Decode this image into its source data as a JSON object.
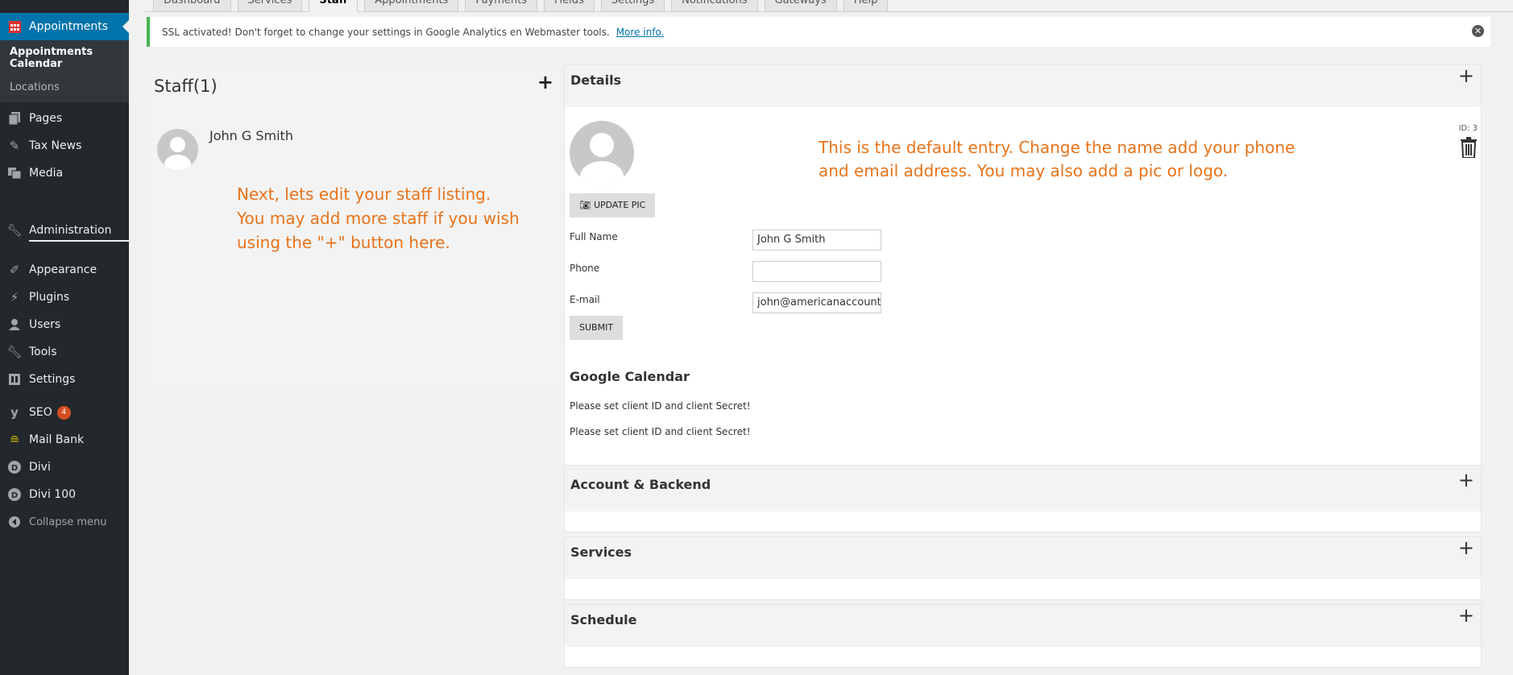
{
  "sidebar": {
    "active_item": "Appointments",
    "submenu": {
      "current": "Appointments Calendar",
      "items": [
        "Locations"
      ]
    },
    "items_group1": [
      "Pages",
      "Tax News",
      "Media"
    ],
    "admin_label": "Administration",
    "items_group2": [
      "Appearance",
      "Plugins",
      "Users",
      "Tools",
      "Settings"
    ],
    "seo_label": "SEO",
    "seo_badge": "4",
    "items_group3": [
      "Mail Bank",
      "Divi",
      "Divi 100"
    ],
    "collapse_label": "Collapse menu"
  },
  "tabs": [
    "Dashboard",
    "Services",
    "Staff",
    "Appointments",
    "Payments",
    "Fields",
    "Settings",
    "Notifications",
    "Gateways",
    "Help"
  ],
  "active_tab": "Staff",
  "notice": {
    "text": "SSL activated!  Don't forget to change your settings in Google Analytics en Webmaster tools.",
    "link": "More info."
  },
  "staff": {
    "title": "Staff(1)",
    "add_symbol": "+",
    "member_name": "John G Smith",
    "note": [
      "Next, lets edit your staff listing.",
      "You may add more staff if you wish",
      "using the \"+\" button here."
    ]
  },
  "details": {
    "title": "Details",
    "id_label": "ID: 3",
    "update_pic_label": "UPDATE PIC",
    "note": [
      "This is the default entry. Change the name add your phone",
      "and email address. You may also add a pic or logo."
    ],
    "fields": {
      "full_name_label": "Full Name",
      "full_name_value": "John G Smith",
      "phone_label": "Phone",
      "phone_value": "",
      "email_label": "E-mail",
      "email_value": "john@americanaccounti"
    },
    "submit_label": "SUBMIT",
    "google_calendar_title": "Google Calendar",
    "google_msg_1": "Please set client ID and client Secret!",
    "google_msg_2": "Please set client ID and client Secret!"
  },
  "sections": {
    "account": "Account & Backend",
    "services": "Services",
    "schedule": "Schedule"
  },
  "colors": {
    "sidebar_bg": "#23282d",
    "accent": "#0073aa",
    "annotation": "#e8731a",
    "notice_border": "#46b450"
  }
}
